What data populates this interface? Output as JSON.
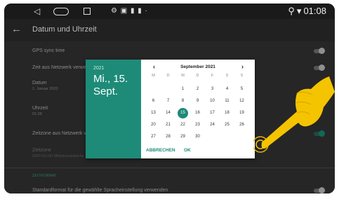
{
  "status_bar": {
    "notifications": "⚙ ▣ ▮ ▮ ·",
    "time": "01:08",
    "location_icon": "location-icon",
    "wifi_icon": "wifi-icon"
  },
  "app_bar": {
    "title": "Datum und Uhrzeit"
  },
  "settings": {
    "gps_sync": "GPS sync time",
    "network_time": "Zeit aus Netzwerk verwe",
    "date_label": "Datum",
    "date_value": "1. Januar 2020",
    "time_label": "Uhrzeit",
    "time_value": "01:08",
    "network_zone": "Zeitzone aus Netzwerk v",
    "zone_label": "Zeitzone",
    "zone_value": "GMT+01:00 Mitteleuropäische",
    "section_header": "ZEITFORMAT",
    "standard_format": "Standardformat für die gewählte Spracheinstellung verwenden"
  },
  "dialog": {
    "year": "2021",
    "date_line1": "Mi., 15.",
    "date_line2": "Sept.",
    "month": "September 2021",
    "prev": "‹",
    "next": "›",
    "weekdays": [
      "M",
      "D",
      "M",
      "D",
      "F",
      "S",
      "S"
    ],
    "weeks": [
      [
        "",
        "",
        "1",
        "2",
        "3",
        "4",
        "5"
      ],
      [
        "6",
        "7",
        "8",
        "9",
        "10",
        "11",
        "12"
      ],
      [
        "13",
        "14",
        "15",
        "16",
        "17",
        "18",
        "19"
      ],
      [
        "20",
        "21",
        "22",
        "23",
        "24",
        "25",
        "26"
      ],
      [
        "27",
        "28",
        "29",
        "30",
        "",
        "",
        ""
      ]
    ],
    "selected_day": "15",
    "cancel": "ABBRECHEN",
    "ok": "OK"
  },
  "colors": {
    "accent": "#1d8b78",
    "hand": "#f5c400"
  }
}
